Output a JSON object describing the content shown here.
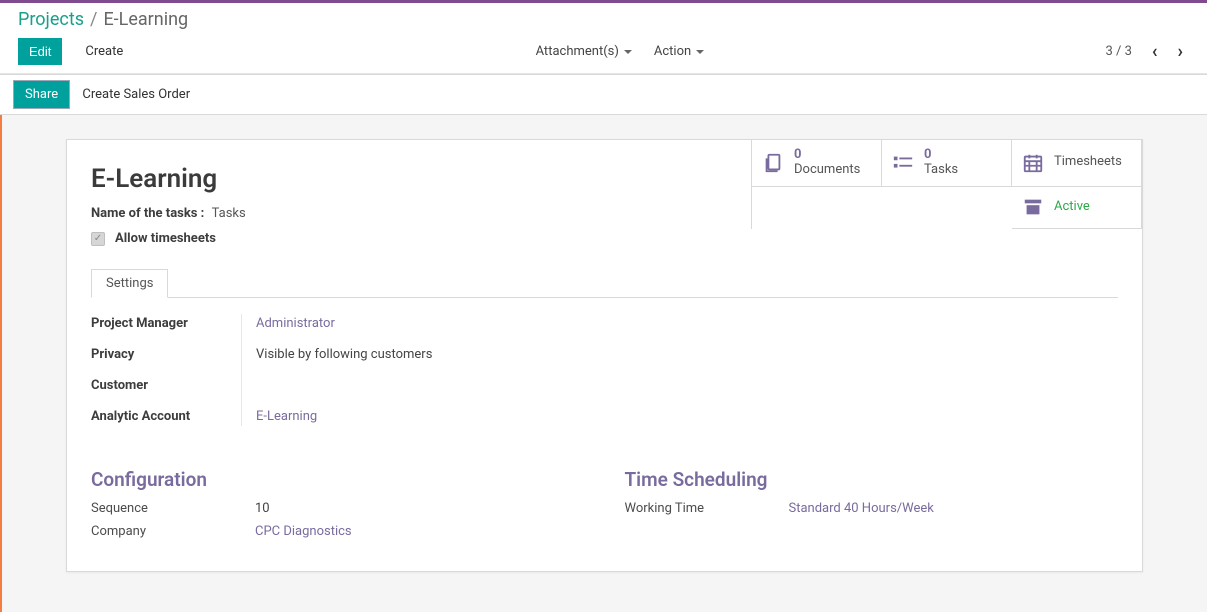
{
  "breadcrumb": {
    "root": "Projects",
    "sep": "/",
    "current": "E-Learning"
  },
  "controls": {
    "edit": "Edit",
    "create": "Create",
    "attachments": "Attachment(s)",
    "action": "Action"
  },
  "pager": {
    "text": "3 / 3"
  },
  "status": {
    "share": "Share",
    "createSalesOrder": "Create Sales Order"
  },
  "title": "E-Learning",
  "tasksLabel": {
    "label": "Name of the tasks :",
    "value": "Tasks"
  },
  "checkbox": {
    "label": "Allow timesheets",
    "checked": true
  },
  "tabs": {
    "settings": "Settings"
  },
  "stat": {
    "documents": {
      "count": "0",
      "label": "Documents"
    },
    "tasks": {
      "count": "0",
      "label": "Tasks"
    },
    "timesheets": {
      "label": "Timesheets"
    },
    "active": {
      "label": "Active"
    }
  },
  "settings": {
    "projectManager": {
      "label": "Project Manager",
      "value": "Administrator"
    },
    "privacy": {
      "label": "Privacy",
      "value": "Visible by following customers"
    },
    "customer": {
      "label": "Customer"
    },
    "analyticAccount": {
      "label": "Analytic Account",
      "value": "E-Learning"
    }
  },
  "configuration": {
    "heading": "Configuration",
    "sequence": {
      "label": "Sequence",
      "value": "10"
    },
    "company": {
      "label": "Company",
      "value": "CPC Diagnostics"
    }
  },
  "timeScheduling": {
    "heading": "Time Scheduling",
    "workingTime": {
      "label": "Working Time",
      "value": "Standard 40 Hours/Week"
    }
  }
}
